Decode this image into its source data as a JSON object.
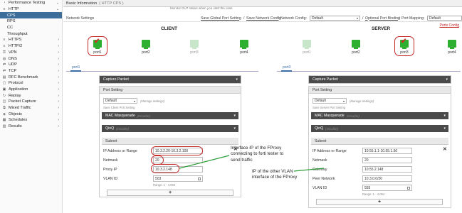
{
  "sidebar": {
    "items": [
      {
        "label": "Performance Testing",
        "icon": "gauge-icon",
        "arrow": "⌄",
        "sub": false
      },
      {
        "label": "HTTP",
        "icon": "list-icon",
        "arrow": "⌄",
        "sub": false
      },
      {
        "label": "CPS",
        "icon": "",
        "arrow": "",
        "sub": true
      },
      {
        "label": "RPS",
        "icon": "",
        "arrow": "",
        "sub": true
      },
      {
        "label": "CC",
        "icon": "",
        "arrow": "",
        "sub": true
      },
      {
        "label": "Throughput",
        "icon": "",
        "arrow": "",
        "sub": true
      },
      {
        "label": "HTTPS",
        "icon": "list-icon",
        "arrow": "›",
        "sub": false
      },
      {
        "label": "HTTP/2",
        "icon": "list-icon",
        "arrow": "›",
        "sub": false
      },
      {
        "label": "VPN",
        "icon": "lock-icon",
        "arrow": "›",
        "sub": false
      },
      {
        "label": "DNS",
        "icon": "globe-icon",
        "arrow": "›",
        "sub": false
      },
      {
        "label": "UDP",
        "icon": "arrows-icon",
        "arrow": "›",
        "sub": false
      },
      {
        "label": "TCP",
        "icon": "arrows-icon",
        "arrow": "›",
        "sub": false
      },
      {
        "label": "RFC Benchmark",
        "icon": "chart-icon",
        "arrow": "›",
        "sub": false
      },
      {
        "label": "Protocol",
        "icon": "doc-icon",
        "arrow": "›",
        "sub": false
      },
      {
        "label": "Application",
        "icon": "app-icon",
        "arrow": "›",
        "sub": false
      },
      {
        "label": "Replay",
        "icon": "replay-icon",
        "arrow": "›",
        "sub": false
      },
      {
        "label": "Packet Capture",
        "icon": "capture-icon",
        "arrow": "›",
        "sub": false
      },
      {
        "label": "Mixed Traffic",
        "icon": "mix-icon",
        "arrow": "›",
        "sub": false
      },
      {
        "label": "Objects",
        "icon": "cube-icon",
        "arrow": "›",
        "sub": false
      },
      {
        "label": "Schedules",
        "icon": "calendar-icon",
        "arrow": "›",
        "sub": false
      },
      {
        "label": "Results",
        "icon": "results-icon",
        "arrow": "›",
        "sub": false
      }
    ]
  },
  "header": {
    "title": "Basic Information",
    "sub": "( HTTP CPS )",
    "hint": "Monitor DUT status when you start the case"
  },
  "network": {
    "label": "Network Settings",
    "save_global": "Save Global Port Setting",
    "save_config": "Save Network Config",
    "config_label": "Network Config:",
    "config_value": "Default",
    "optional": "Optional Port Binding",
    "port_mapping": "Port Mapping:",
    "mapping_value": "Default",
    "ports_config": "Ports Config"
  },
  "client": {
    "title": "CLIENT",
    "ports": [
      "port1",
      "port2",
      "port3",
      "port4"
    ],
    "tab": "port1",
    "capture": "Capture Packet",
    "port_setting": "Port Setting",
    "setting_value": "Default",
    "manage": "(Manage Settings)",
    "save": "Save Client Port Setting",
    "mac": "MAC Masquerade",
    "mac_status": "(Disable)",
    "qinq": "QinQ",
    "qinq_status": "(Disable)",
    "subnet": "Subnet",
    "ip_label": "IP Address or Range",
    "ip": "10.3.2.20-10.3.2.100",
    "netmask_label": "Netmask",
    "netmask": "20",
    "proxy_label": "Proxy IP",
    "proxy": "10.3.2.148",
    "vlan_label": "VLAN ID",
    "vlan": "503",
    "range": "Range: 1 - 4,094",
    "plus": "+"
  },
  "server": {
    "title": "SERVER",
    "ports": [
      "port1",
      "port2",
      "port3",
      "port4"
    ],
    "tab": "port3",
    "capture": "Capture Packet",
    "port_setting": "Port Setting",
    "setting_value": "Default",
    "manage": "(Manage Settings)",
    "save": "Save Server Port Setting",
    "mac": "MAC Masquerade",
    "mac_status": "(Disable)",
    "qinq": "QinQ",
    "qinq_status": "(Disable)",
    "subnet": "Subnet",
    "ip_label": "IP Address or Range",
    "ip": "10.55.1.1-10.55.1.50",
    "netmask_label": "Netmask",
    "netmask": "20",
    "gateway_label": "Gateway",
    "gateway": "10.55.2.148",
    "peer_label": "Peer Network",
    "peer": "10.3.0.0/20",
    "vlan_label": "VLAN ID",
    "vlan": "555",
    "range": "Range: 1 - 4,094",
    "plus": "+"
  },
  "annotations": {
    "client_note": [
      "Interface IP of the FProxy",
      "connecting to forti tester to",
      "send traffic"
    ],
    "server_note": [
      "IP of the other VLAN",
      "interface of the FProxy"
    ]
  },
  "colors": {
    "accent": "#3f6d9a",
    "port_active": "#2db030",
    "annotation_ring": "#c62828",
    "arrow": "#2e9e3a"
  }
}
